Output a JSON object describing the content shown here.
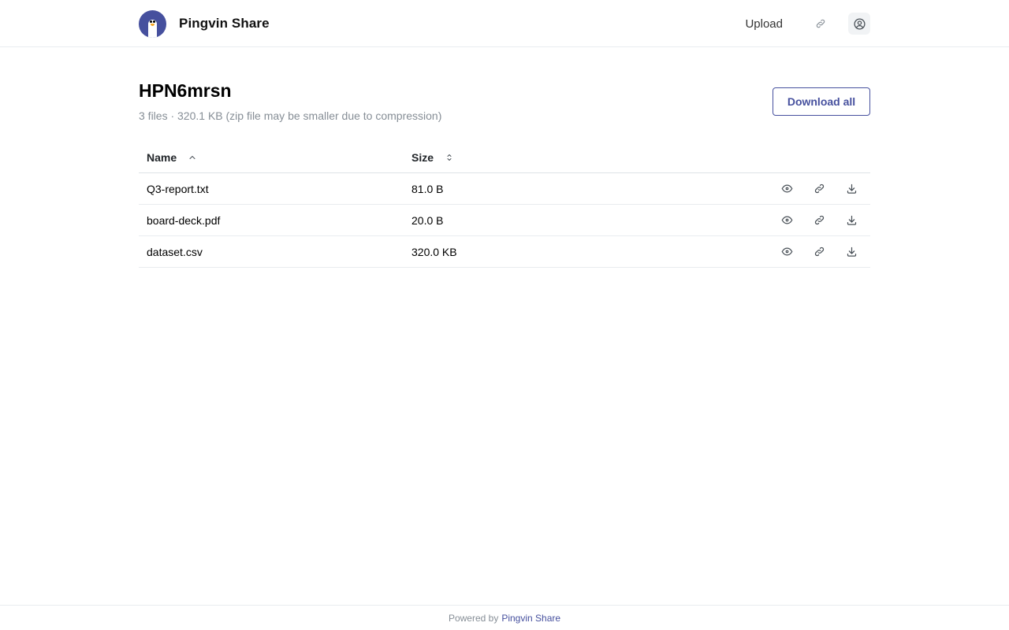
{
  "app": {
    "name": "Pingvin Share",
    "accent_color": "#46509e"
  },
  "header": {
    "logo_icon": "penguin-logo-icon",
    "nav": {
      "upload_label": "Upload",
      "link_icon": "link-icon",
      "user_icon": "user-circle-icon"
    }
  },
  "share": {
    "id": "HPN6mrsn",
    "summary": "3 files · 320.1 KB (zip file may be smaller due to compression)",
    "download_all_label": "Download all"
  },
  "table": {
    "columns": [
      {
        "label": "Name",
        "sort_icon": "chevron-up-icon"
      },
      {
        "label": "Size",
        "sort_icon": "selector-icon"
      }
    ],
    "rows": [
      {
        "name": "Q3-report.txt",
        "size": "81.0 B"
      },
      {
        "name": "board-deck.pdf",
        "size": "20.0 B"
      },
      {
        "name": "dataset.csv",
        "size": "320.0 KB"
      }
    ],
    "row_actions": [
      "eye-icon",
      "link-icon",
      "download-icon"
    ]
  },
  "footer": {
    "prefix": "Powered by",
    "link_label": "Pingvin Share"
  }
}
